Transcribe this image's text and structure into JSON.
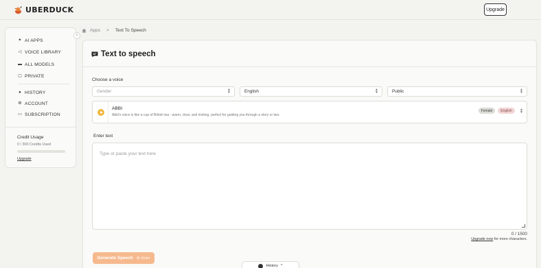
{
  "brand": {
    "name": "UBERDUCK"
  },
  "header": {
    "upgrade_label": "Upgrade"
  },
  "sidebar": {
    "collapse_glyph": "‹",
    "items": [
      {
        "label": "AI APPS",
        "icon": "sparkle-icon"
      },
      {
        "label": "VOICE LIBRARY",
        "icon": "speaker-icon"
      },
      {
        "label": "ALL MODELS",
        "icon": "folder-icon"
      },
      {
        "label": "PRIVATE",
        "icon": "lock-icon"
      },
      {
        "label": "HISTORY",
        "icon": "clock-icon"
      },
      {
        "label": "ACCOUNT",
        "icon": "gear-icon"
      },
      {
        "label": "SUBSCRIPTION",
        "icon": "card-icon"
      }
    ],
    "credits": {
      "title": "Credit Usage",
      "used_text": "0 / 300 Credits Used",
      "used_fraction": 0,
      "upgrade_label": "Upgrade"
    }
  },
  "breadcrumb": {
    "root": "Apps",
    "separator": ">",
    "current": "Text To Speech"
  },
  "main": {
    "title": "Text to speech",
    "choose_voice_label": "Choose a voice",
    "filters": {
      "gender_placeholder": "Gender",
      "language_value": "English",
      "visibility_value": "Public"
    },
    "voice": {
      "name": "ABBI",
      "description": "Abbi's voice is like a cup of British tea - warm, clear, and inviting, perfect for guiding you through a story or two.",
      "gender_badge": "Female",
      "language_badge": "English"
    },
    "enter_text_label": "Enter text",
    "textarea_placeholder": "Type or paste your text here",
    "char_count": "0 / 1500",
    "upgrade_link": "Upgrade now",
    "upgrade_suffix": "for more characters.",
    "generate_label": "Generate Speech",
    "generate_shortcut": "⌘+Enter"
  },
  "history_tab": {
    "label": "History",
    "chevron": "^"
  },
  "colors": {
    "accent": "#f6b98e",
    "play": "#f0b840",
    "background": "#f3f3ef"
  }
}
